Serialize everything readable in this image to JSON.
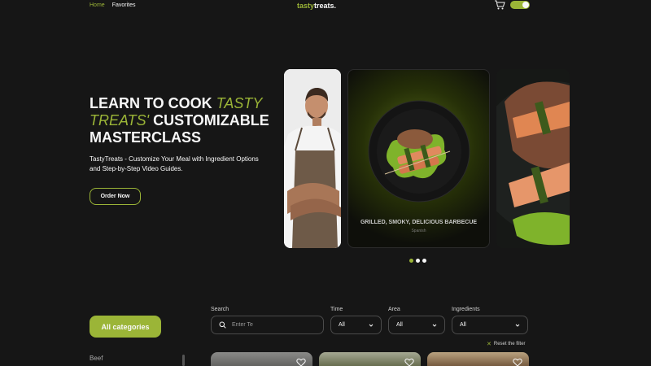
{
  "header": {
    "nav": {
      "home": "Home",
      "favorites": "Favorites"
    },
    "logo": {
      "main": "tasty",
      "accent": "treats."
    },
    "colors": {
      "accent": "#9bb537",
      "background": "#161616"
    },
    "icons": [
      "cart-icon",
      "theme-toggle"
    ]
  },
  "hero": {
    "title_part1": "LEARN TO COOK ",
    "title_accent": "TASTY TREATS'",
    "title_part2": " CUSTOMIZABLE MASTERCLASS",
    "description": "TastyTreats - Customize Your Meal with Ingredient Options and Step-by-Step Video Guides.",
    "order_button": "Order Now"
  },
  "slider": {
    "caption": "GRILLED, SMOKY, DELICIOUS BARBECUE",
    "subcaption": "Spanish",
    "dots": 3,
    "active_dot": 0
  },
  "filters": {
    "all_categories": "All categories",
    "first_category": "Beef",
    "search_label": "Search",
    "search_placeholder": "Enter Te",
    "time_label": "Time",
    "time_value": "All",
    "area_label": "Area",
    "area_value": "All",
    "ingredients_label": "Ingredients",
    "ingredients_value": "All",
    "reset": "Reset the filter"
  }
}
